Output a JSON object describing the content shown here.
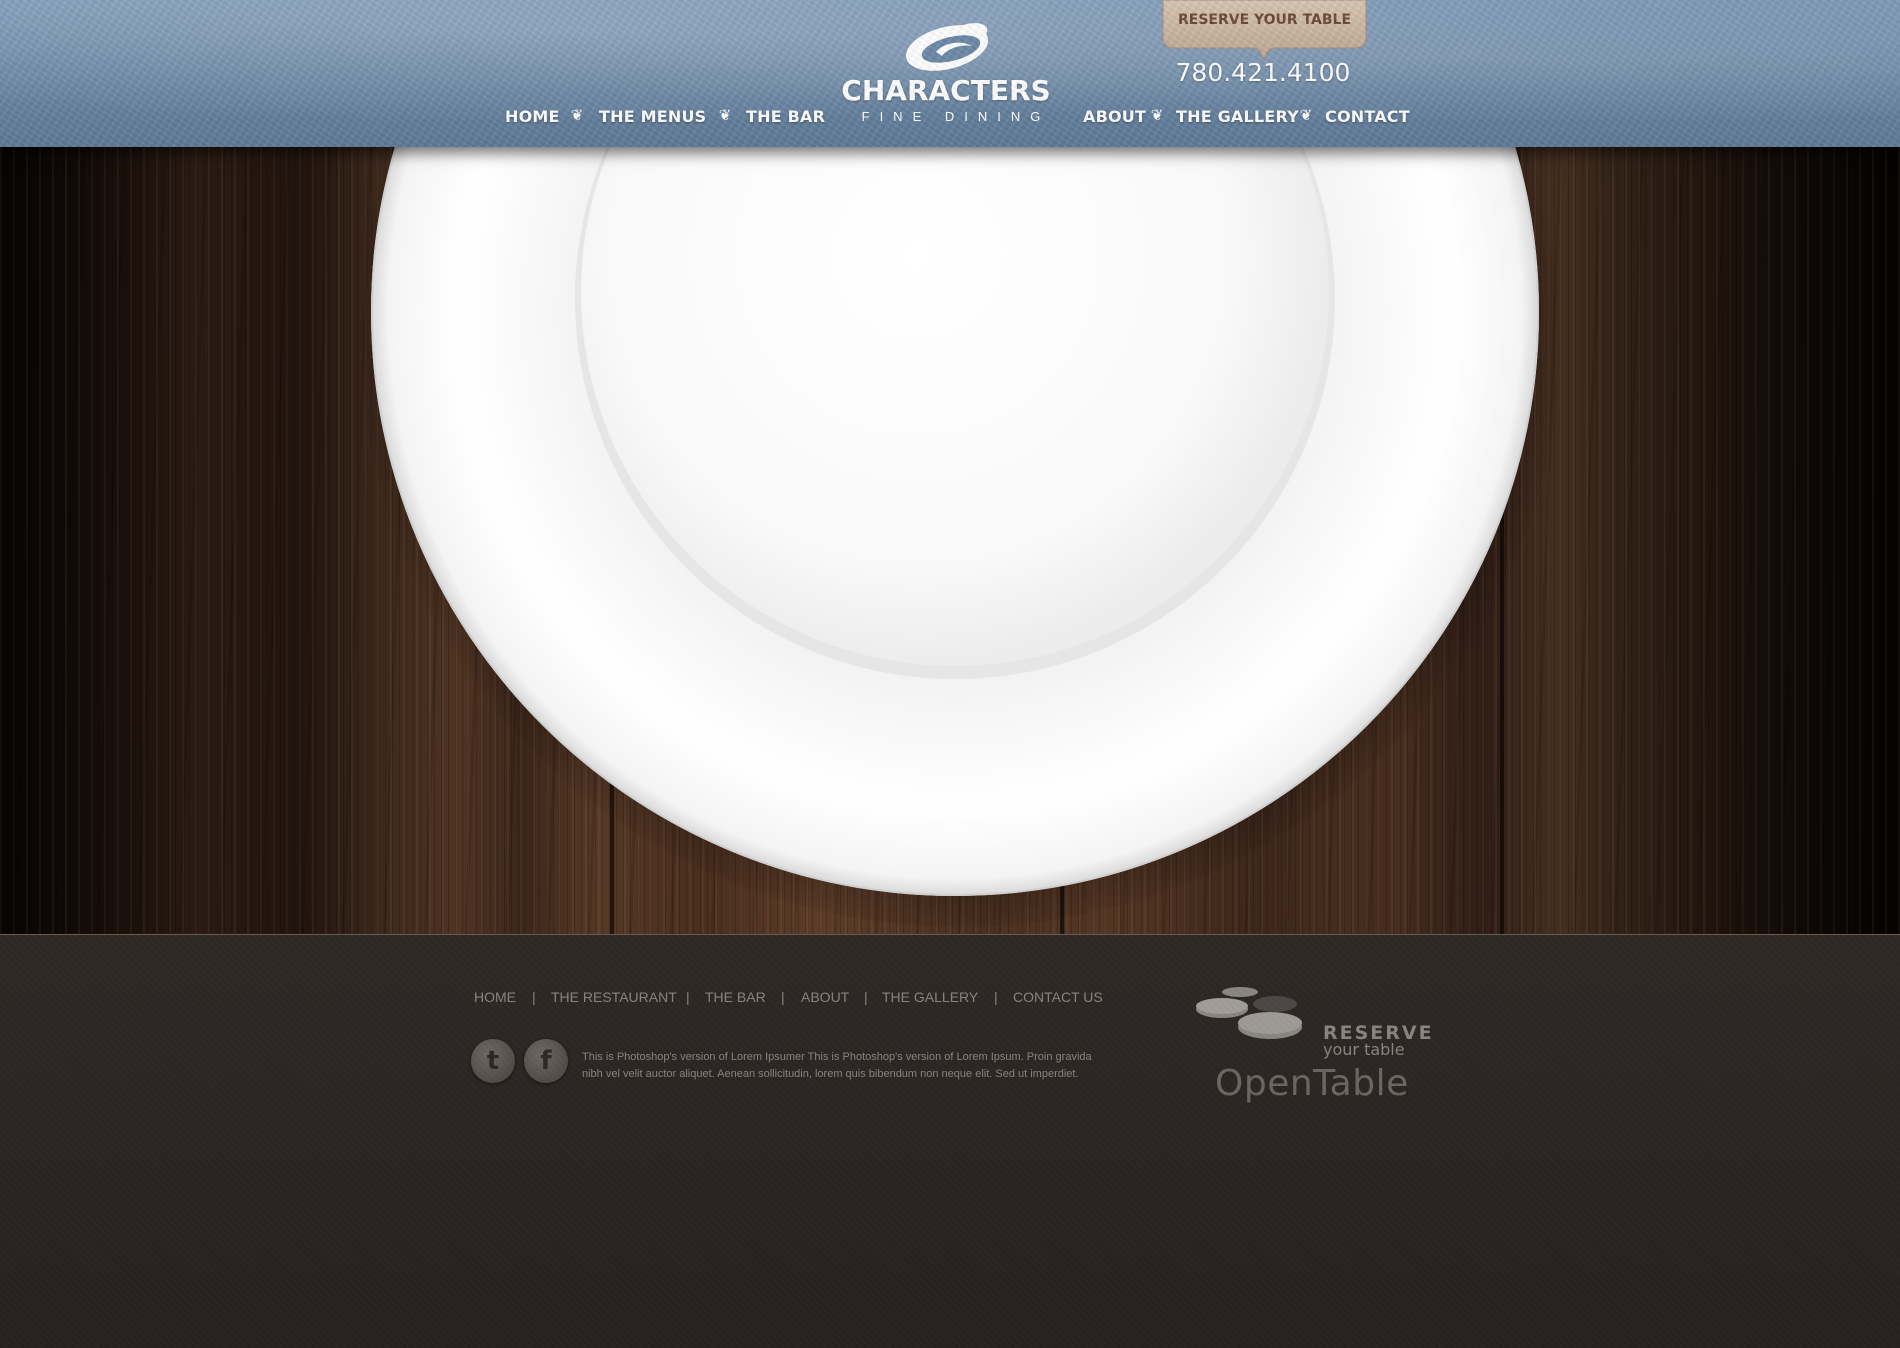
{
  "header": {
    "nav_left": [
      {
        "label": "HOME"
      },
      {
        "label": "THE MENUS"
      },
      {
        "label": "THE BAR"
      }
    ],
    "nav_right": [
      {
        "label": "ABOUT"
      },
      {
        "label": "THE GALLERY"
      },
      {
        "label": "CONTACT"
      }
    ],
    "logo": {
      "name": "CHARACTERS",
      "tagline": "FINE DINING"
    },
    "reserve_label": "RESERVE YOUR TABLE",
    "phone": "780.421.4100",
    "separator_icon": "flourish-icon"
  },
  "footer": {
    "nav": [
      {
        "label": "HOME"
      },
      {
        "label": "THE RESTAURANT"
      },
      {
        "label": "THE BAR"
      },
      {
        "label": "ABOUT"
      },
      {
        "label": "THE GALLERY"
      },
      {
        "label": "CONTACT US"
      }
    ],
    "nav_separator": "|",
    "social": [
      {
        "icon": "twitter-icon",
        "glyph": "t"
      },
      {
        "icon": "facebook-icon",
        "glyph": "f"
      }
    ],
    "text_line1": "This is Photoshop's version of Lorem Ipsumer This is Photoshop's version  of Lorem Ipsum. Proin gravida",
    "text_line2": "nibh vel velit auctor aliquet. Aenean sollicitudin, lorem quis bibendum  non neque elit. Sed ut imperdiet.",
    "opentable": {
      "reserve": "RESERVE",
      "your_table": "your table",
      "brand": "OpenTable"
    }
  },
  "colors": {
    "header_blue": "#6d89a7",
    "reserve_tab": "#c9b6a3",
    "footer_bg": "#2b2623",
    "footer_text": "#8a847e"
  }
}
